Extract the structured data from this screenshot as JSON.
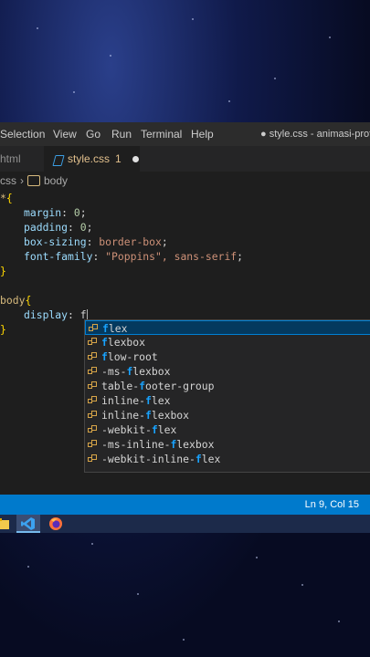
{
  "menu": {
    "items": [
      "Selection",
      "View",
      "Go",
      "Run",
      "Terminal",
      "Help"
    ],
    "window_title": "● style.css - animasi-profil-"
  },
  "tabs": [
    {
      "label": "html"
    },
    {
      "label": "style.css",
      "problems": "1",
      "dirty": true
    }
  ],
  "breadcrumb": {
    "file": "css",
    "symbol": "body"
  },
  "editor": {
    "lines": [
      {
        "text": "*{"
      },
      {
        "prop": "margin",
        "value": "0"
      },
      {
        "prop": "padding",
        "value": "0"
      },
      {
        "prop": "box-sizing",
        "value": "border-box"
      },
      {
        "prop": "font-family",
        "value": "\"Poppins\", sans-serif"
      },
      {
        "text": "}"
      },
      {
        "text": "body{"
      },
      {
        "prop": "display",
        "value": "f"
      },
      {
        "text": "}"
      }
    ]
  },
  "suggestions": [
    {
      "typed": "f",
      "rest": "lex",
      "prefix": ""
    },
    {
      "typed": "f",
      "rest": "lexbox",
      "prefix": ""
    },
    {
      "typed": "f",
      "rest": "low-root",
      "prefix": ""
    },
    {
      "typed": "f",
      "rest": "lexbox",
      "prefix": "-ms-"
    },
    {
      "typed": "f",
      "rest": "ooter-group",
      "prefix": "table-"
    },
    {
      "typed": "f",
      "rest": "lex",
      "prefix": "inline-"
    },
    {
      "typed": "f",
      "rest": "lexbox",
      "prefix": "inline-"
    },
    {
      "typed": "f",
      "rest": "lex",
      "prefix": "-webkit-"
    },
    {
      "typed": "f",
      "rest": "lexbox",
      "prefix": "-ms-inline-"
    },
    {
      "typed": "f",
      "rest": "lex",
      "prefix": "-webkit-inline-"
    }
  ],
  "status": {
    "position": "Ln 9, Col 15"
  },
  "taskbar": {
    "icons": [
      "file-explorer-icon",
      "vscode-icon",
      "firefox-icon"
    ]
  },
  "colors": {
    "accent": "#007acc",
    "selection": "#04395e",
    "match_highlight": "#18a3ff"
  }
}
